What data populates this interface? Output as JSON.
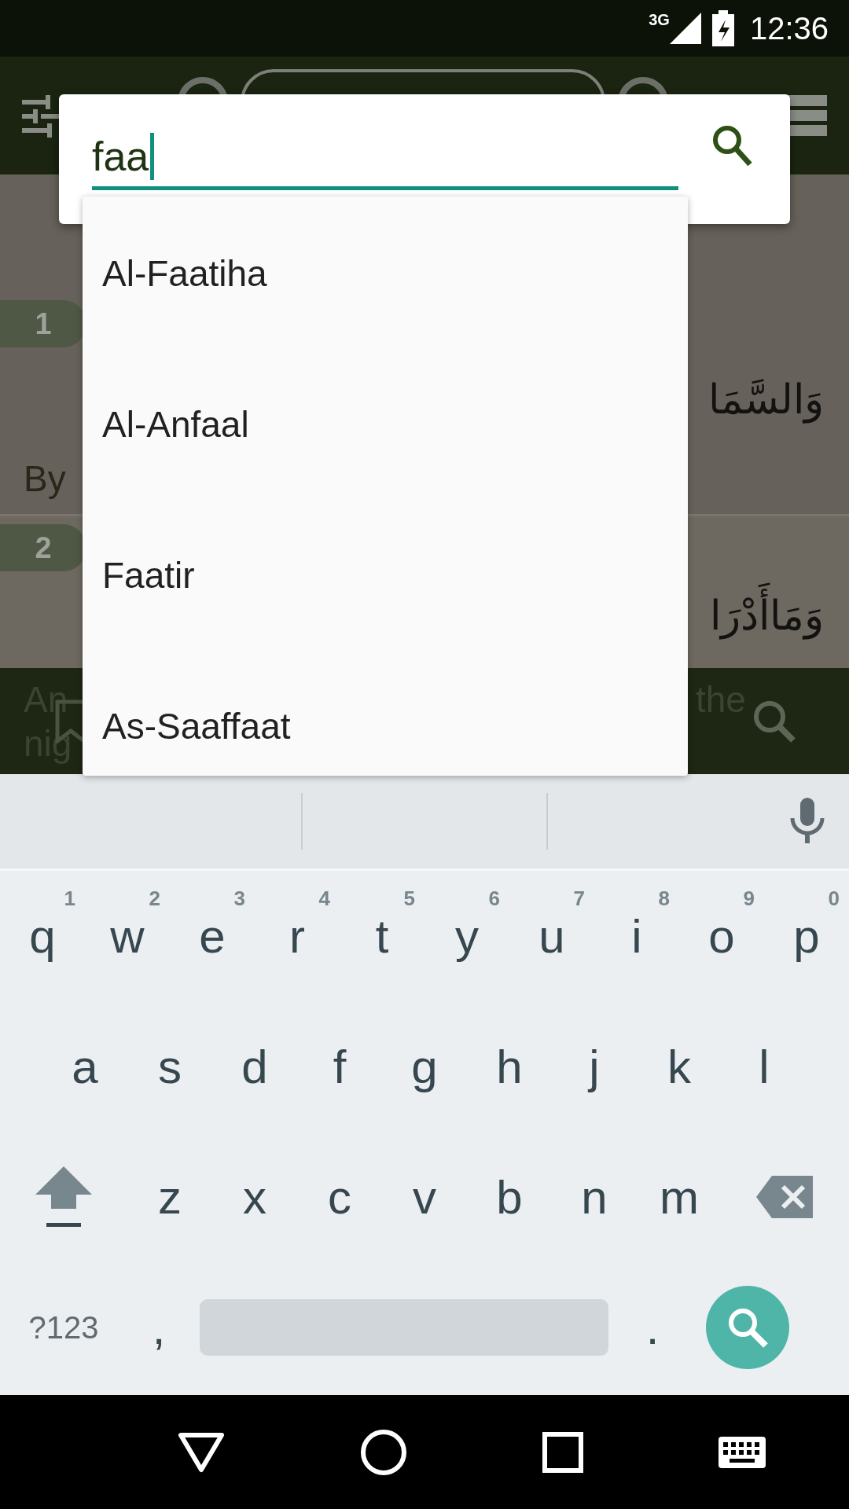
{
  "status_bar": {
    "network": "3G",
    "time": "12:36"
  },
  "verses": [
    {
      "number": "1",
      "arabic": "وَالسَّمَا",
      "translation": "By"
    },
    {
      "number": "2",
      "arabic": "وَمَاأَدْرَا"
    }
  ],
  "bottom_bar": {
    "text_start": [
      "An",
      "nig"
    ],
    "text_end": "the"
  },
  "search": {
    "value": "faa"
  },
  "suggestions": [
    "Al-Faatiha",
    "Al-Anfaal",
    "Faatir",
    "As-Saaffaat"
  ],
  "keyboard": {
    "rows": [
      [
        {
          "key": "q",
          "hint": "1"
        },
        {
          "key": "w",
          "hint": "2"
        },
        {
          "key": "e",
          "hint": "3"
        },
        {
          "key": "r",
          "hint": "4"
        },
        {
          "key": "t",
          "hint": "5"
        },
        {
          "key": "y",
          "hint": "6"
        },
        {
          "key": "u",
          "hint": "7"
        },
        {
          "key": "i",
          "hint": "8"
        },
        {
          "key": "o",
          "hint": "9"
        },
        {
          "key": "p",
          "hint": "0"
        }
      ],
      [
        {
          "key": "a"
        },
        {
          "key": "s"
        },
        {
          "key": "d"
        },
        {
          "key": "f"
        },
        {
          "key": "g"
        },
        {
          "key": "h"
        },
        {
          "key": "j"
        },
        {
          "key": "k"
        },
        {
          "key": "l"
        }
      ],
      [
        {
          "key": "z"
        },
        {
          "key": "x"
        },
        {
          "key": "c"
        },
        {
          "key": "v"
        },
        {
          "key": "b"
        },
        {
          "key": "n"
        },
        {
          "key": "m"
        }
      ]
    ],
    "symbols": "?123",
    "comma": ",",
    "period": "."
  }
}
